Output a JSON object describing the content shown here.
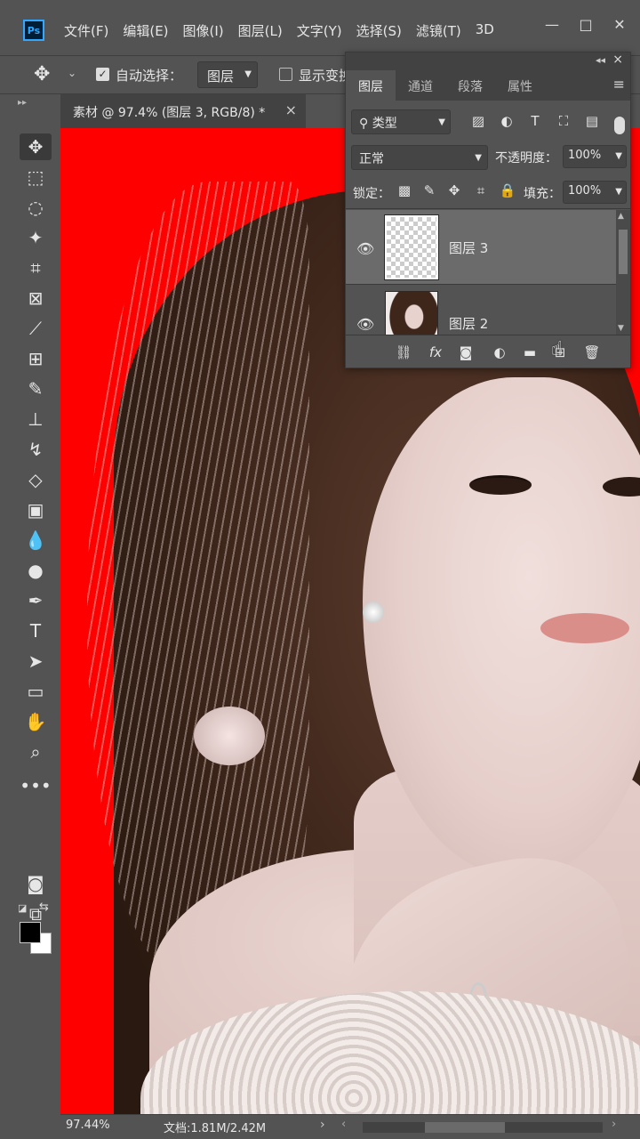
{
  "app": {
    "logo": "Ps",
    "menu": [
      "文件(F)",
      "编辑(E)",
      "图像(I)",
      "图层(L)",
      "文字(Y)",
      "选择(S)",
      "滤镜(T)",
      "3D"
    ]
  },
  "options": {
    "auto_select_label": "自动选择：",
    "auto_select_checked": true,
    "auto_select_target": "图层",
    "show_transform_label": "显示变换控件"
  },
  "document": {
    "tab_label": "素材 @ 97.4% (图层 3, RGB/8) *",
    "close": "×"
  },
  "status": {
    "zoom": "97.44%",
    "doc_info": "文档:1.81M/2.42M"
  },
  "layers_panel": {
    "tabs": [
      "图层",
      "通道",
      "段落",
      "属性"
    ],
    "active_tab": "图层",
    "filter_label": "类型",
    "blend_mode": "正常",
    "opacity_label": "不透明度：",
    "opacity_value": "100%",
    "lock_label": "锁定：",
    "fill_label": "填充：",
    "fill_value": "100%",
    "layers": [
      {
        "name": "图层 3",
        "selected": true,
        "visible": true,
        "thumb": "transparent"
      },
      {
        "name": "图层 2",
        "selected": false,
        "visible": true,
        "thumb": "photo"
      }
    ]
  },
  "colors": {
    "canvas_background": "#ff0000",
    "ui_background": "#535353",
    "foreground_swatch": "#000000",
    "background_swatch": "#ffffff"
  }
}
